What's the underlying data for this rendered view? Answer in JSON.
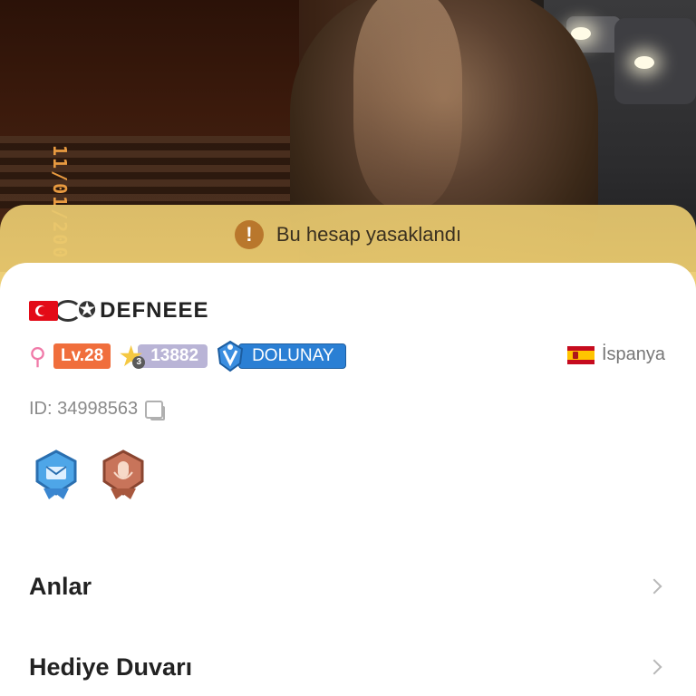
{
  "banner": {
    "message": "Bu hesap yasaklandı",
    "icon": "exclamation-icon"
  },
  "photo": {
    "date_stamp": "11/01/200"
  },
  "profile": {
    "username": "DEFNEEE",
    "name_prefix_icons": [
      "turkey-flag-icon",
      "swirl-icon",
      "star-icon"
    ],
    "gender_icon": "female-icon",
    "level": "Lv.28",
    "star_badge_number": "3",
    "points": "13882",
    "tier": "DOLUNAY",
    "country": "İspanya",
    "country_flag": "spain-flag-icon",
    "id_text": "ID: 34998563"
  },
  "medals": [
    "shield-envelope-medal-icon",
    "microphone-medal-icon"
  ],
  "menu": [
    {
      "label": "Anlar"
    },
    {
      "label": "Hediye Duvarı"
    }
  ],
  "colors": {
    "banner_bg": "#ECCC6E",
    "level_badge": "#F06E3C",
    "points_badge": "#B9B4D6",
    "tier_badge": "#2A7FD4",
    "gender": "#F07AA8"
  }
}
